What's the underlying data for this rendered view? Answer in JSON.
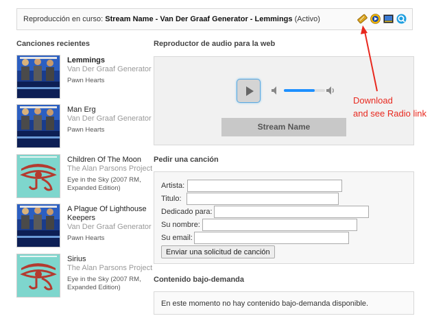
{
  "now_playing": {
    "prefix": "Reproducción en curso:",
    "track": "Stream Name - Van Der Graaf Generator - Lemmings",
    "status": "(Activo)",
    "icons": [
      "download-icon",
      "winamp-play-icon",
      "media-player-icon",
      "quicktime-icon"
    ]
  },
  "recent": {
    "title": "Canciones recientes",
    "songs": [
      {
        "title": "Lemmings",
        "artist": "Van Der Graaf Generator",
        "album": "Pawn Hearts",
        "cover": "pawn-hearts-cover"
      },
      {
        "title": "Man Erg",
        "artist": "Van Der Graaf Generator",
        "album": "Pawn Hearts",
        "cover": "pawn-hearts-cover"
      },
      {
        "title": "Children Of The Moon",
        "artist": "The Alan Parsons Project",
        "album": "Eye in the Sky (2007 RM, Expanded Edition)",
        "cover": "eye-in-the-sky-cover"
      },
      {
        "title": "A Plague Of Lighthouse Keepers",
        "artist": "Van Der Graaf Generator",
        "album": "Pawn Hearts",
        "cover": "pawn-hearts-cover"
      },
      {
        "title": "Sirius",
        "artist": "The Alan Parsons Project",
        "album": "Eye in the Sky (2007 RM, Expanded Edition)",
        "cover": "eye-in-the-sky-cover"
      }
    ]
  },
  "player": {
    "title": "Reproductor de audio para la web",
    "stream_name": "Stream Name",
    "volume": 0.75
  },
  "request": {
    "title": "Pedir una canción",
    "fields": {
      "artist": "Artista:",
      "title": "Titulo:",
      "dedicated": "Dedicado para:",
      "name": "Su nombre:",
      "email": "Su email:"
    },
    "submit": "Enviar una solicitud de canción"
  },
  "ondemand": {
    "title": "Contenido bajo-demanda",
    "message": "En este momento no hay contenido bajo-demanda disponible."
  },
  "annotation": {
    "line1": "Download",
    "line2": "and see Radio link",
    "color": "#e8281e"
  }
}
